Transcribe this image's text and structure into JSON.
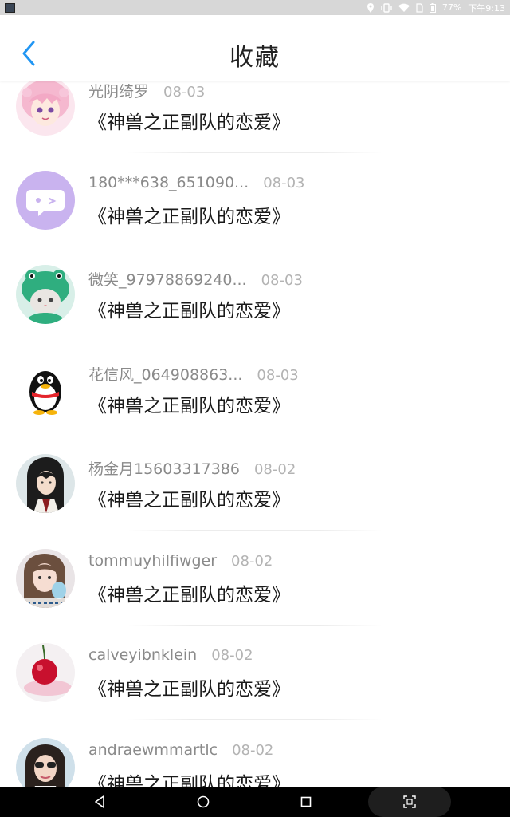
{
  "status_bar": {
    "time": "下午9:13",
    "battery": "77%"
  },
  "header": {
    "title": "收藏"
  },
  "items": [
    {
      "user": "光阴绮罗",
      "date": "08-03",
      "title": "《神兽之正副队的恋爱》",
      "avatar": "anime-girl-avatar"
    },
    {
      "user": "180***638_651090...",
      "date": "08-03",
      "title": "《神兽之正副队的恋爱》",
      "avatar": "purple-chat-avatar"
    },
    {
      "user": "微笑_97978869240...",
      "date": "08-03",
      "title": "《神兽之正副队的恋爱》",
      "avatar": "cat-frog-hat-avatar"
    },
    {
      "user": "花信风_064908863...",
      "date": "08-03",
      "title": "《神兽之正副队的恋爱》",
      "avatar": "penguin-avatar"
    },
    {
      "user": "杨金月15603317386",
      "date": "08-02",
      "title": "《神兽之正副队的恋爱》",
      "avatar": "anime-man-avatar"
    },
    {
      "user": "tommuyhilfiwger",
      "date": "08-02",
      "title": "《神兽之正副队的恋爱》",
      "avatar": "girl-photo-avatar"
    },
    {
      "user": "calveyibnklein",
      "date": "08-02",
      "title": "《神兽之正副队的恋爱》",
      "avatar": "cherry-avatar"
    },
    {
      "user": "andraewmmartlc",
      "date": "08-02",
      "title": "《神兽之正副队的恋爱》",
      "avatar": "woman-photo-avatar"
    }
  ],
  "colors": {
    "accent": "#2196f3",
    "status_bar": "#d7d7d7",
    "nav_bar": "#000000"
  }
}
